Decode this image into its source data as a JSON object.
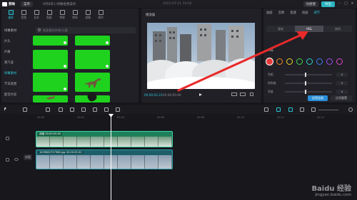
{
  "app": {
    "name": "剪映",
    "menu_label": "菜单",
    "project_name": "9月8日1-绿幕抠像操作",
    "project_date": "2021-07-21 14:02",
    "btn_shortcut": "快捷键",
    "btn_export": "导出"
  },
  "media": {
    "tabs": [
      {
        "label": "媒体",
        "icon": "media-icon"
      },
      {
        "label": "音频",
        "icon": "audio-icon"
      },
      {
        "label": "文本",
        "icon": "text-icon"
      },
      {
        "label": "贴纸",
        "icon": "sticker-icon"
      },
      {
        "label": "特效",
        "icon": "effects-icon"
      },
      {
        "label": "转场",
        "icon": "transition-icon"
      },
      {
        "label": "滤镜",
        "icon": "filter-icon"
      },
      {
        "label": "调节",
        "icon": "adjust-icon"
      }
    ],
    "categories": [
      "绿幕素材",
      "片头",
      "片尾",
      "蒸汽波",
      "绿幕素材",
      "节日氛围",
      "配音片段"
    ],
    "active_category_index": 4,
    "search_placeholder": "搜索素材名称/元素",
    "thumb_color": "#1ed21e"
  },
  "player": {
    "title": "播放器",
    "time_current": "00:00:02:23",
    "time_total": "00:00:05:00",
    "ratio_label": "比例"
  },
  "inspector": {
    "tabs": [
      "画面",
      "音频",
      "变速",
      "动画",
      "调节"
    ],
    "active_tab_index": 4,
    "subtabs": [
      "基础",
      "HSL",
      "曲线"
    ],
    "active_subtab_index": 1,
    "hsl_title": "HSL",
    "swatches": [
      "#e63b3b",
      "#f08a24",
      "#f2d12b",
      "#3fd24a",
      "#2bd3c9",
      "#3a7df0",
      "#9a4cf0",
      "#e048c8"
    ],
    "sliders": [
      {
        "label": "色相",
        "value": "0"
      },
      {
        "label": "饱和度",
        "value": "0"
      },
      {
        "label": "亮度",
        "value": "0"
      }
    ],
    "apply_all_label": "应用全部",
    "reset_label": "应用重置"
  },
  "timeline": {
    "ruler": [
      "00:00",
      "00:02",
      "00:04",
      "00:06",
      "00:08",
      "00:10",
      "00:12",
      "00:14"
    ],
    "top_clip_label": "绿幕  00:00:05:00",
    "main_clip_label": "1629882757988.jpg  00:00:05:00",
    "cover_label": "封面"
  },
  "watermark": {
    "brand": "Baidu 经验",
    "url": "jingyan.baidu.com"
  }
}
